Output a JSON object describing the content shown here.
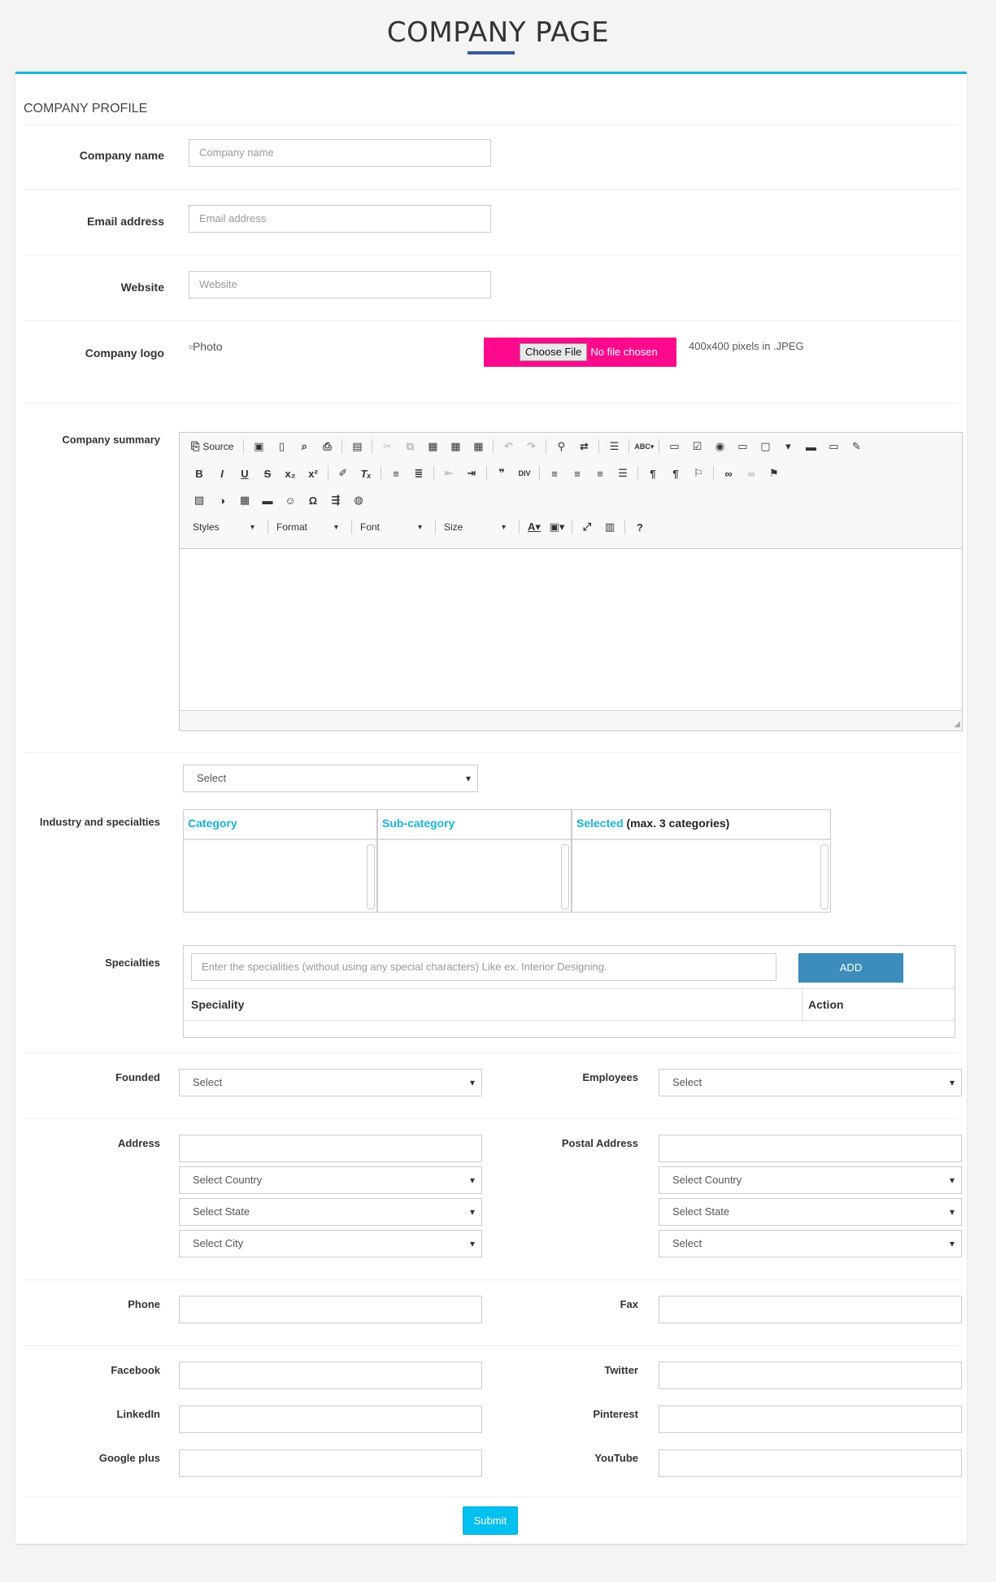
{
  "page": {
    "title": "COMPANY PAGE"
  },
  "profile": {
    "title": "COMPANY PROFILE"
  },
  "fields": {
    "company_name": {
      "label": "Company name",
      "placeholder": "Company name"
    },
    "email": {
      "label": "Email address",
      "placeholder": "Email address"
    },
    "website": {
      "label": "Website",
      "placeholder": "Website"
    },
    "logo": {
      "label": "Company logo",
      "alt": "Photo",
      "choose": "Choose File",
      "no_file": "No file chosen",
      "hint": "400x400 pixels in .JPEG"
    },
    "summary": {
      "label": "Company summary"
    }
  },
  "editor": {
    "source": "Source",
    "combos": [
      "Styles",
      "Format",
      "Font",
      "Size"
    ],
    "icons_row1": [
      "new-page-icon",
      "save-icon",
      "preview-icon",
      "print-icon",
      "templates-icon",
      "cut-icon",
      "copy-icon",
      "paste-icon",
      "paste-text-icon",
      "paste-word-icon",
      "undo-icon",
      "redo-icon",
      "find-icon",
      "replace-icon",
      "select-all-icon",
      "spellcheck-icon",
      "form-icon",
      "checkbox-icon",
      "radio-icon",
      "textfield-icon",
      "textarea-icon",
      "select-field-icon",
      "button-icon",
      "image-button-icon",
      "hidden-field-icon"
    ],
    "icons_row2": [
      "bold-icon",
      "italic-icon",
      "underline-icon",
      "strike-icon",
      "subscript-icon",
      "superscript-icon",
      "copy-format-icon",
      "remove-format-icon",
      "numbered-list-icon",
      "bulleted-list-icon",
      "outdent-icon",
      "indent-icon",
      "blockquote-icon",
      "div-icon",
      "align-left-icon",
      "align-center-icon",
      "align-right-icon",
      "justify-icon",
      "ltr-icon",
      "rtl-icon",
      "language-icon",
      "link-icon",
      "unlink-icon",
      "anchor-icon"
    ],
    "icons_row3": [
      "image-icon",
      "flash-icon",
      "table-icon",
      "hr-icon",
      "smiley-icon",
      "special-char-icon",
      "page-break-icon",
      "iframe-icon"
    ],
    "icons_row4": [
      "text-color-icon",
      "bg-color-icon",
      "maximize-icon",
      "show-blocks-icon",
      "help-icon"
    ]
  },
  "industry": {
    "label": "Industry and specialties",
    "select": "Select",
    "category": "Category",
    "sub_category": "Sub-category",
    "selected": "Selected",
    "selected_note": "(max. 3 categories)"
  },
  "specialties": {
    "label": "Specialties",
    "placeholder": "Enter the specialities (without using any special characters) Like ex. Interior Designing.",
    "add": "ADD",
    "col_speciality": "Speciality",
    "col_action": "Action"
  },
  "founded": {
    "label": "Founded",
    "value": "Select"
  },
  "employees": {
    "label": "Employees",
    "value": "Select"
  },
  "address": {
    "label": "Address",
    "country": "Select Country",
    "state": "Select State",
    "city": "Select City"
  },
  "postal": {
    "label": "Postal Address",
    "country": "Select Country",
    "state": "Select State",
    "city": "Select"
  },
  "phone": {
    "label": "Phone"
  },
  "fax": {
    "label": "Fax"
  },
  "facebook": {
    "label": "Facebook"
  },
  "twitter": {
    "label": "Twitter"
  },
  "linkedin": {
    "label": "LinkedIn"
  },
  "pinterest": {
    "label": "Pinterest"
  },
  "googleplus": {
    "label": "Google plus"
  },
  "youtube": {
    "label": "YouTube"
  },
  "submit": "Submit"
}
